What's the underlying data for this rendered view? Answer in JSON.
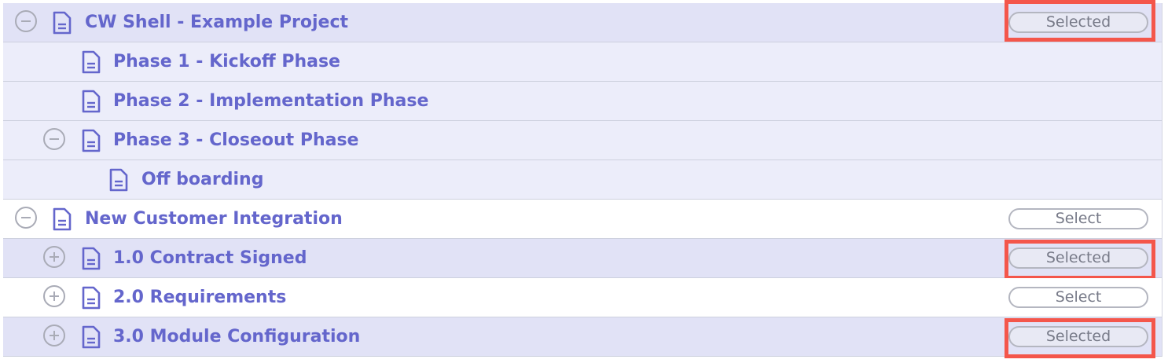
{
  "colors": {
    "accent_text": "#6466cc",
    "row_selected": "#e1e2f6",
    "row_child": "#ecedfa",
    "highlight_red": "#f4564b"
  },
  "rows": [
    {
      "label": "CW Shell - Example Project",
      "toggle": "collapse-icon",
      "button": "Selected",
      "highlighted": true
    },
    {
      "label": "Phase 1 - Kickoff Phase"
    },
    {
      "label": "Phase 2 - Implementation Phase"
    },
    {
      "label": "Phase 3 - Closeout Phase",
      "toggle": "collapse-icon"
    },
    {
      "label": "Off boarding"
    },
    {
      "label": "New Customer Integration",
      "toggle": "collapse-icon",
      "button": "Select",
      "highlighted": false
    },
    {
      "label": "1.0 Contract Signed",
      "toggle": "expand-icon",
      "button": "Selected",
      "highlighted": true
    },
    {
      "label": "2.0 Requirements",
      "toggle": "expand-icon",
      "button": "Select",
      "highlighted": false
    },
    {
      "label": "3.0 Module Configuration",
      "toggle": "expand-icon",
      "button": "Selected",
      "highlighted": true
    }
  ]
}
